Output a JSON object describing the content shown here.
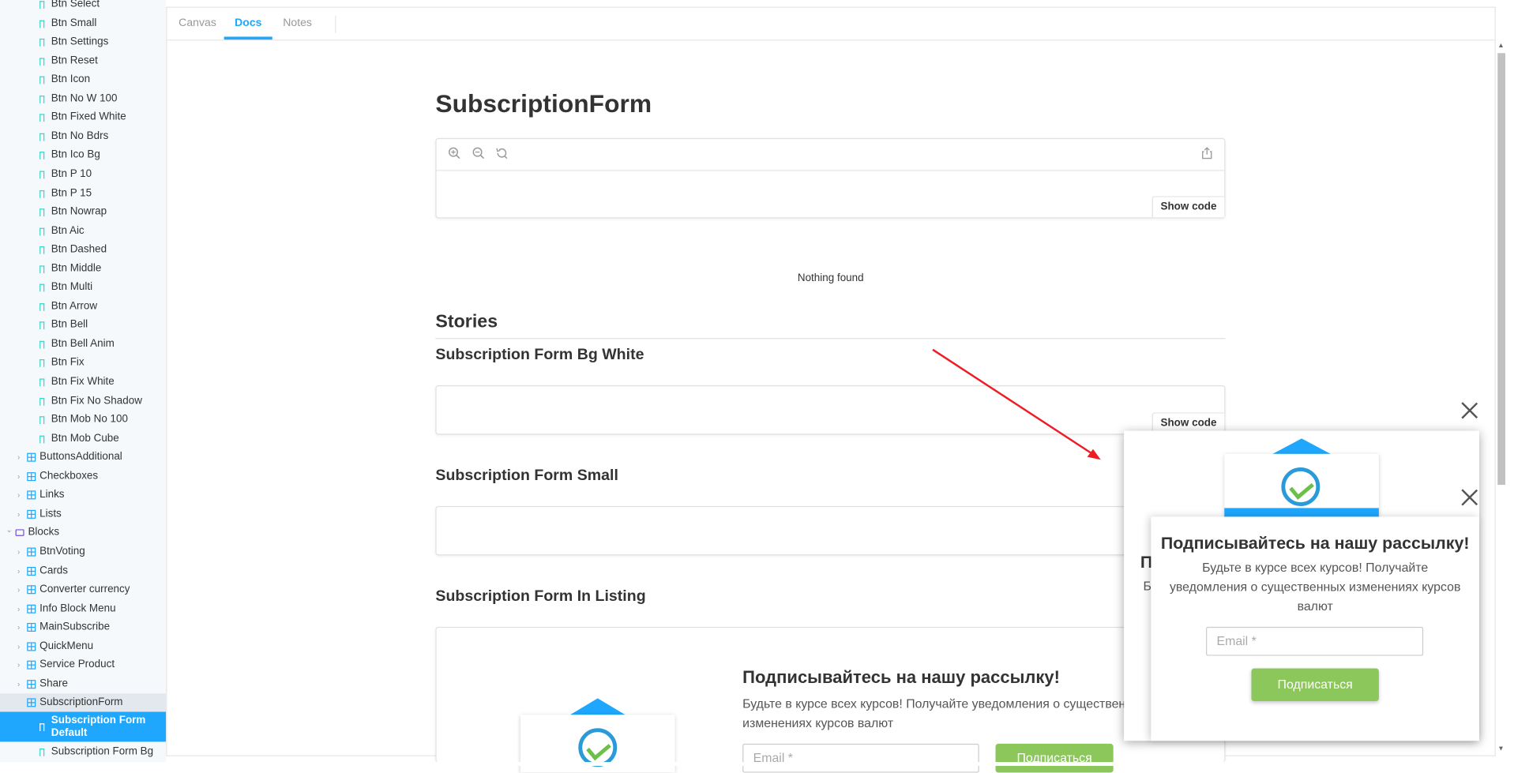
{
  "sidebar": {
    "stories_top": [
      "Btn Select",
      "Btn Small",
      "Btn Settings",
      "Btn Reset",
      "Btn Icon",
      "Btn No W 100",
      "Btn Fixed White",
      "Btn No Bdrs",
      "Btn Ico Bg",
      "Btn P 10",
      "Btn P 15",
      "Btn Nowrap",
      "Btn Aic",
      "Btn Dashed",
      "Btn Middle",
      "Btn Multi",
      "Btn Arrow",
      "Btn Bell",
      "Btn Bell Anim",
      "Btn Fix",
      "Btn Fix White",
      "Btn Fix No Shadow",
      "Btn Mob No 100",
      "Btn Mob Cube"
    ],
    "components_a": [
      "ButtonsAdditional",
      "Checkboxes",
      "Links",
      "Lists"
    ],
    "group": "Blocks",
    "components_b": [
      "BtnVoting",
      "Cards",
      "Converter currency",
      "Info Block Menu",
      "MainSubscribe",
      "QuickMenu",
      "Service Product",
      "Share",
      "SubscriptionForm"
    ],
    "active_story": "Subscription Form Default",
    "next_story": "Subscription Form Bg"
  },
  "tabs": [
    "Canvas",
    "Docs",
    "Notes"
  ],
  "docs": {
    "title": "SubscriptionForm",
    "show_code": "Show code",
    "nothing_found": "Nothing found",
    "stories_heading": "Stories",
    "story1": "Subscription Form Bg White",
    "story2": "Subscription Form Small",
    "story3": "Subscription Form In Listing",
    "listing_title": "Подписывайтесь на нашу рассылку!",
    "listing_desc_line1": "Будьте в курсе всех курсов! Получайте уведомления о существен",
    "listing_desc_line2": "изменениях курсов валют",
    "listing_email": "Email *",
    "listing_btn": "Подписаться"
  },
  "popup": {
    "title": "Подписывайтесь на нашу рассылку!",
    "description": "Будьте в курсе всех курсов! Получайте уведомления о существенных изменениях курсов валют",
    "email_placeholder": "Email *",
    "submit": "Подписаться",
    "behind_title_fragment": "П",
    "behind_desc_fragment": "Б"
  },
  "colors": {
    "accent": "#1ea7fd",
    "button_green": "#8bc75a",
    "arrow": "#ee1c24"
  },
  "icons": [
    "zoom-in-icon",
    "zoom-out-icon",
    "reset-zoom-icon",
    "share-icon",
    "close-icon",
    "logo-icon"
  ]
}
